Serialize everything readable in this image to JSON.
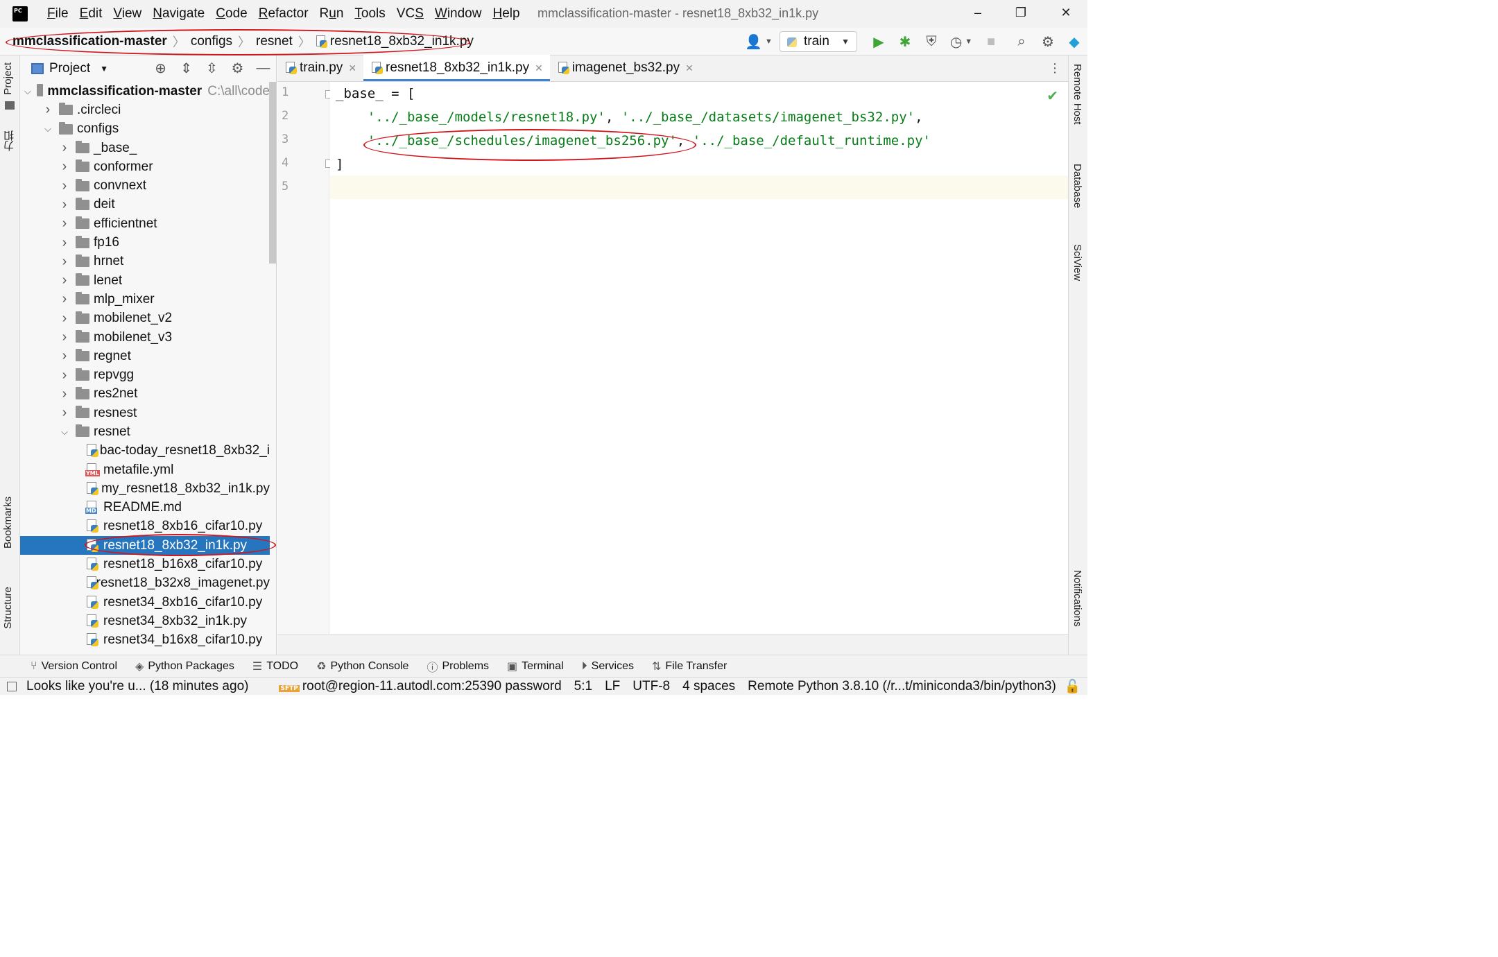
{
  "app": {
    "logo_text": "PC",
    "window_title": "mmclassification-master - resnet18_8xb32_in1k.py",
    "menu": [
      "File",
      "Edit",
      "View",
      "Navigate",
      "Code",
      "Refactor",
      "Run",
      "Tools",
      "VCS",
      "Window",
      "Help"
    ],
    "menu_underline": [
      "F",
      "E",
      "V",
      "N",
      "C",
      "R",
      "u",
      "T",
      "S",
      "W",
      "H"
    ]
  },
  "breadcrumb": [
    "mmclassification-master",
    "configs",
    "resnet",
    "resnet18_8xb32_in1k.py"
  ],
  "run_config": {
    "label": "train"
  },
  "left_strip": {
    "top_tab": "Project",
    "second_tab": "力扣",
    "bookmarks": "Bookmarks",
    "structure": "Structure"
  },
  "project_panel": {
    "title": "Project",
    "root": {
      "name": "mmclassification-master",
      "path_hint": "C:\\all\\code"
    },
    "items": [
      {
        "name": ".circleci",
        "kind": "folder",
        "depth": 1,
        "expanded": false
      },
      {
        "name": "configs",
        "kind": "folder",
        "depth": 1,
        "expanded": true
      },
      {
        "name": "_base_",
        "kind": "folder",
        "depth": 2,
        "expanded": false
      },
      {
        "name": "conformer",
        "kind": "folder",
        "depth": 2,
        "expanded": false
      },
      {
        "name": "convnext",
        "kind": "folder",
        "depth": 2,
        "expanded": false
      },
      {
        "name": "deit",
        "kind": "folder",
        "depth": 2,
        "expanded": false
      },
      {
        "name": "efficientnet",
        "kind": "folder",
        "depth": 2,
        "expanded": false
      },
      {
        "name": "fp16",
        "kind": "folder",
        "depth": 2,
        "expanded": false
      },
      {
        "name": "hrnet",
        "kind": "folder",
        "depth": 2,
        "expanded": false
      },
      {
        "name": "lenet",
        "kind": "folder",
        "depth": 2,
        "expanded": false
      },
      {
        "name": "mlp_mixer",
        "kind": "folder",
        "depth": 2,
        "expanded": false
      },
      {
        "name": "mobilenet_v2",
        "kind": "folder",
        "depth": 2,
        "expanded": false
      },
      {
        "name": "mobilenet_v3",
        "kind": "folder",
        "depth": 2,
        "expanded": false
      },
      {
        "name": "regnet",
        "kind": "folder",
        "depth": 2,
        "expanded": false
      },
      {
        "name": "repvgg",
        "kind": "folder",
        "depth": 2,
        "expanded": false
      },
      {
        "name": "res2net",
        "kind": "folder",
        "depth": 2,
        "expanded": false
      },
      {
        "name": "resnest",
        "kind": "folder",
        "depth": 2,
        "expanded": false
      },
      {
        "name": "resnet",
        "kind": "folder",
        "depth": 2,
        "expanded": true
      },
      {
        "name": "bac-today_resnet18_8xb32_i",
        "kind": "py",
        "depth": 3
      },
      {
        "name": "metafile.yml",
        "kind": "yml",
        "depth": 3
      },
      {
        "name": "my_resnet18_8xb32_in1k.py",
        "kind": "py",
        "depth": 3
      },
      {
        "name": "README.md",
        "kind": "md",
        "depth": 3
      },
      {
        "name": "resnet18_8xb16_cifar10.py",
        "kind": "py",
        "depth": 3
      },
      {
        "name": "resnet18_8xb32_in1k.py",
        "kind": "py",
        "depth": 3,
        "selected": true
      },
      {
        "name": "resnet18_b16x8_cifar10.py",
        "kind": "py",
        "depth": 3
      },
      {
        "name": "resnet18_b32x8_imagenet.py",
        "kind": "py",
        "depth": 3
      },
      {
        "name": "resnet34_8xb16_cifar10.py",
        "kind": "py",
        "depth": 3
      },
      {
        "name": "resnet34_8xb32_in1k.py",
        "kind": "py",
        "depth": 3
      },
      {
        "name": "resnet34_b16x8_cifar10.py",
        "kind": "py",
        "depth": 3
      }
    ]
  },
  "editor": {
    "tabs": [
      {
        "label": "train.py",
        "active": false
      },
      {
        "label": "resnet18_8xb32_in1k.py",
        "active": true
      },
      {
        "label": "imagenet_bs32.py",
        "active": false
      }
    ],
    "line_numbers": [
      "1",
      "2",
      "3",
      "4",
      "5"
    ],
    "code": {
      "l1": "_base_ = [",
      "l2_a": "'../_base_/models/resnet18.py'",
      "l2_b": "'../_base_/datasets/imagenet_bs32.py'",
      "l3_a": "'../_base_/schedules/imagenet_bs256.py'",
      "l3_b": "'../_base_/default_runtime.py'",
      "l4": "]"
    }
  },
  "right_strip": [
    "Remote Host",
    "Database",
    "SciView",
    "Notifications"
  ],
  "bottom_tools": [
    "Version Control",
    "Python Packages",
    "TODO",
    "Python Console",
    "Problems",
    "Terminal",
    "Services",
    "File Transfer"
  ],
  "status_bar": {
    "message": "Looks like you're u... (18 minutes ago)",
    "sftp_badge": "SFTP",
    "connection": "root@region-11.autodl.com:25390 password",
    "position": "5:1",
    "line_sep": "LF",
    "encoding": "UTF-8",
    "indent": "4 spaces",
    "interpreter": "Remote Python 3.8.10 (/r...t/miniconda3/bin/python3)"
  },
  "colors": {
    "selection": "#2675bf",
    "string": "#067d17",
    "annotation": "#d0161c",
    "run_green": "#3fa535"
  }
}
